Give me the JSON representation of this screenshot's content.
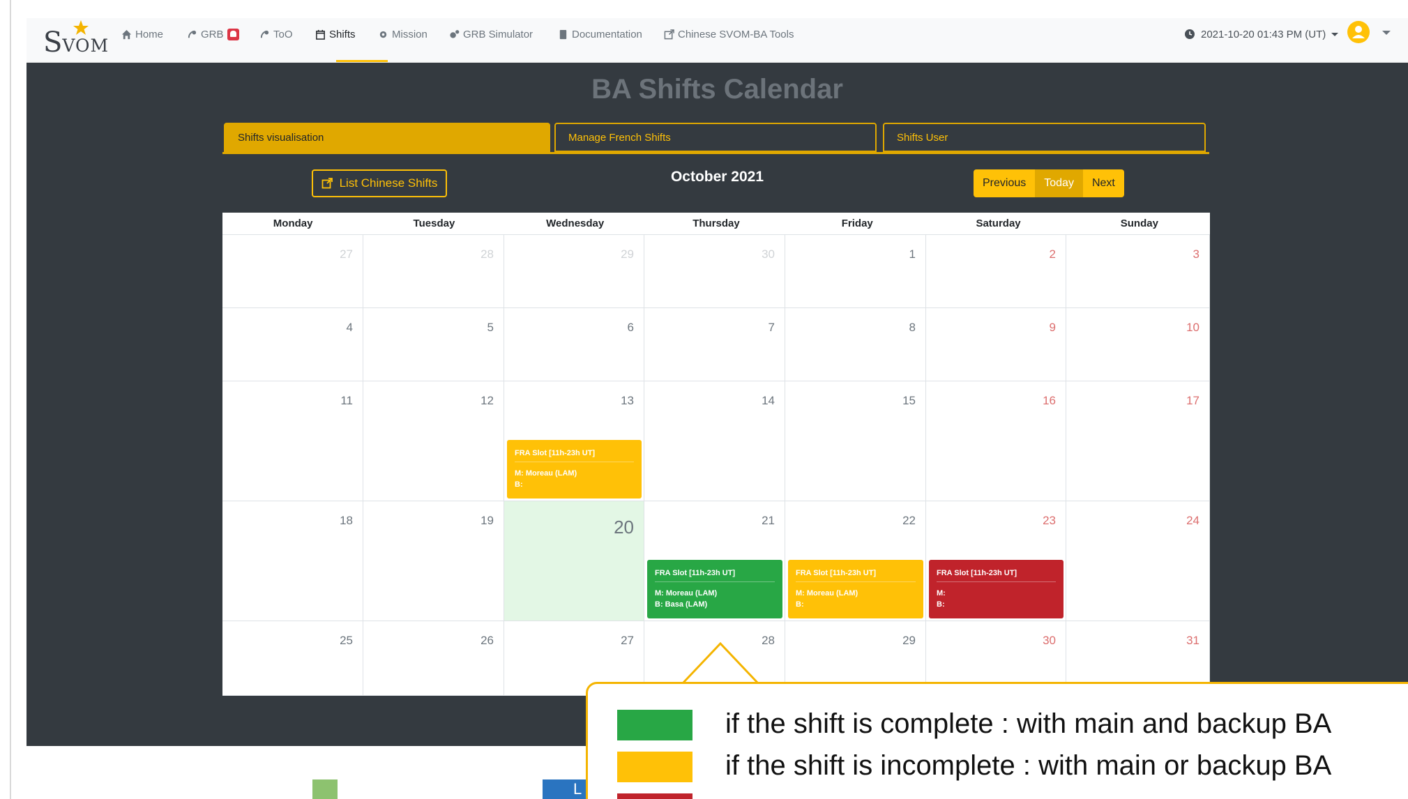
{
  "navbar": {
    "logo_s": "S",
    "logo_rest": "VOM",
    "items": [
      {
        "label": "Home",
        "icon": "home-icon"
      },
      {
        "label": "GRB",
        "icon": "satellite-icon",
        "badge": "alert-badge"
      },
      {
        "label": "ToO",
        "icon": "satellite-icon"
      },
      {
        "label": "Shifts",
        "icon": "calendar-icon",
        "active": true
      },
      {
        "label": "Mission",
        "icon": "gear-icon"
      },
      {
        "label": "GRB Simulator",
        "icon": "gears-icon"
      },
      {
        "label": "Documentation",
        "icon": "book-icon"
      },
      {
        "label": "Chinese SVOM-BA Tools",
        "icon": "external-link-icon"
      }
    ],
    "datetime": "2021-10-20 01:43 PM (UT)",
    "accent": "#ffc107"
  },
  "page": {
    "title": "BA Shifts Calendar",
    "tabs": [
      "Shifts visualisation",
      "Manage French Shifts",
      "Shifts User"
    ],
    "list_button": "List Chinese Shifts",
    "month": "October 2021",
    "nav_buttons": [
      "Previous",
      "Today",
      "Next"
    ]
  },
  "calendar": {
    "weekdays": [
      "Monday",
      "Tuesday",
      "Wednesday",
      "Thursday",
      "Friday",
      "Saturday",
      "Sunday"
    ],
    "weeks": [
      [
        "27",
        "28",
        "29",
        "30",
        "1",
        "2",
        "3"
      ],
      [
        "4",
        "5",
        "6",
        "7",
        "8",
        "9",
        "10"
      ],
      [
        "11",
        "12",
        "13",
        "14",
        "15",
        "16",
        "17"
      ],
      [
        "18",
        "19",
        "20",
        "21",
        "22",
        "23",
        "24"
      ],
      [
        "25",
        "26",
        "27",
        "28",
        "29",
        "30",
        "31"
      ]
    ],
    "today": "20",
    "events": [
      {
        "date": "13",
        "title": "FRA Slot [11h-23h UT]",
        "main": "M:  Moreau (LAM)",
        "backup": "B:",
        "status": "incomplete",
        "color": "#ffc107"
      },
      {
        "date": "21",
        "title": "FRA Slot [11h-23h UT]",
        "main": "M:  Moreau (LAM)",
        "backup": "B:  Basa (LAM)",
        "status": "complete",
        "color": "#28a745"
      },
      {
        "date": "22",
        "title": "FRA Slot [11h-23h UT]",
        "main": "M:  Moreau (LAM)",
        "backup": "B:",
        "status": "incomplete",
        "color": "#ffc107"
      },
      {
        "date": "23",
        "title": "FRA Slot [11h-23h UT]",
        "main": "M:",
        "backup": "B:",
        "status": "empty",
        "color": "#c0232b"
      }
    ]
  },
  "legend": {
    "complete": {
      "text": "if the shift is complete : with main and backup BA",
      "color": "#28a745"
    },
    "incomplete": {
      "text": "if the shift is incomplete : with main or backup BA",
      "color": "#ffc107"
    },
    "empty": {
      "color": "#c0232b"
    }
  }
}
